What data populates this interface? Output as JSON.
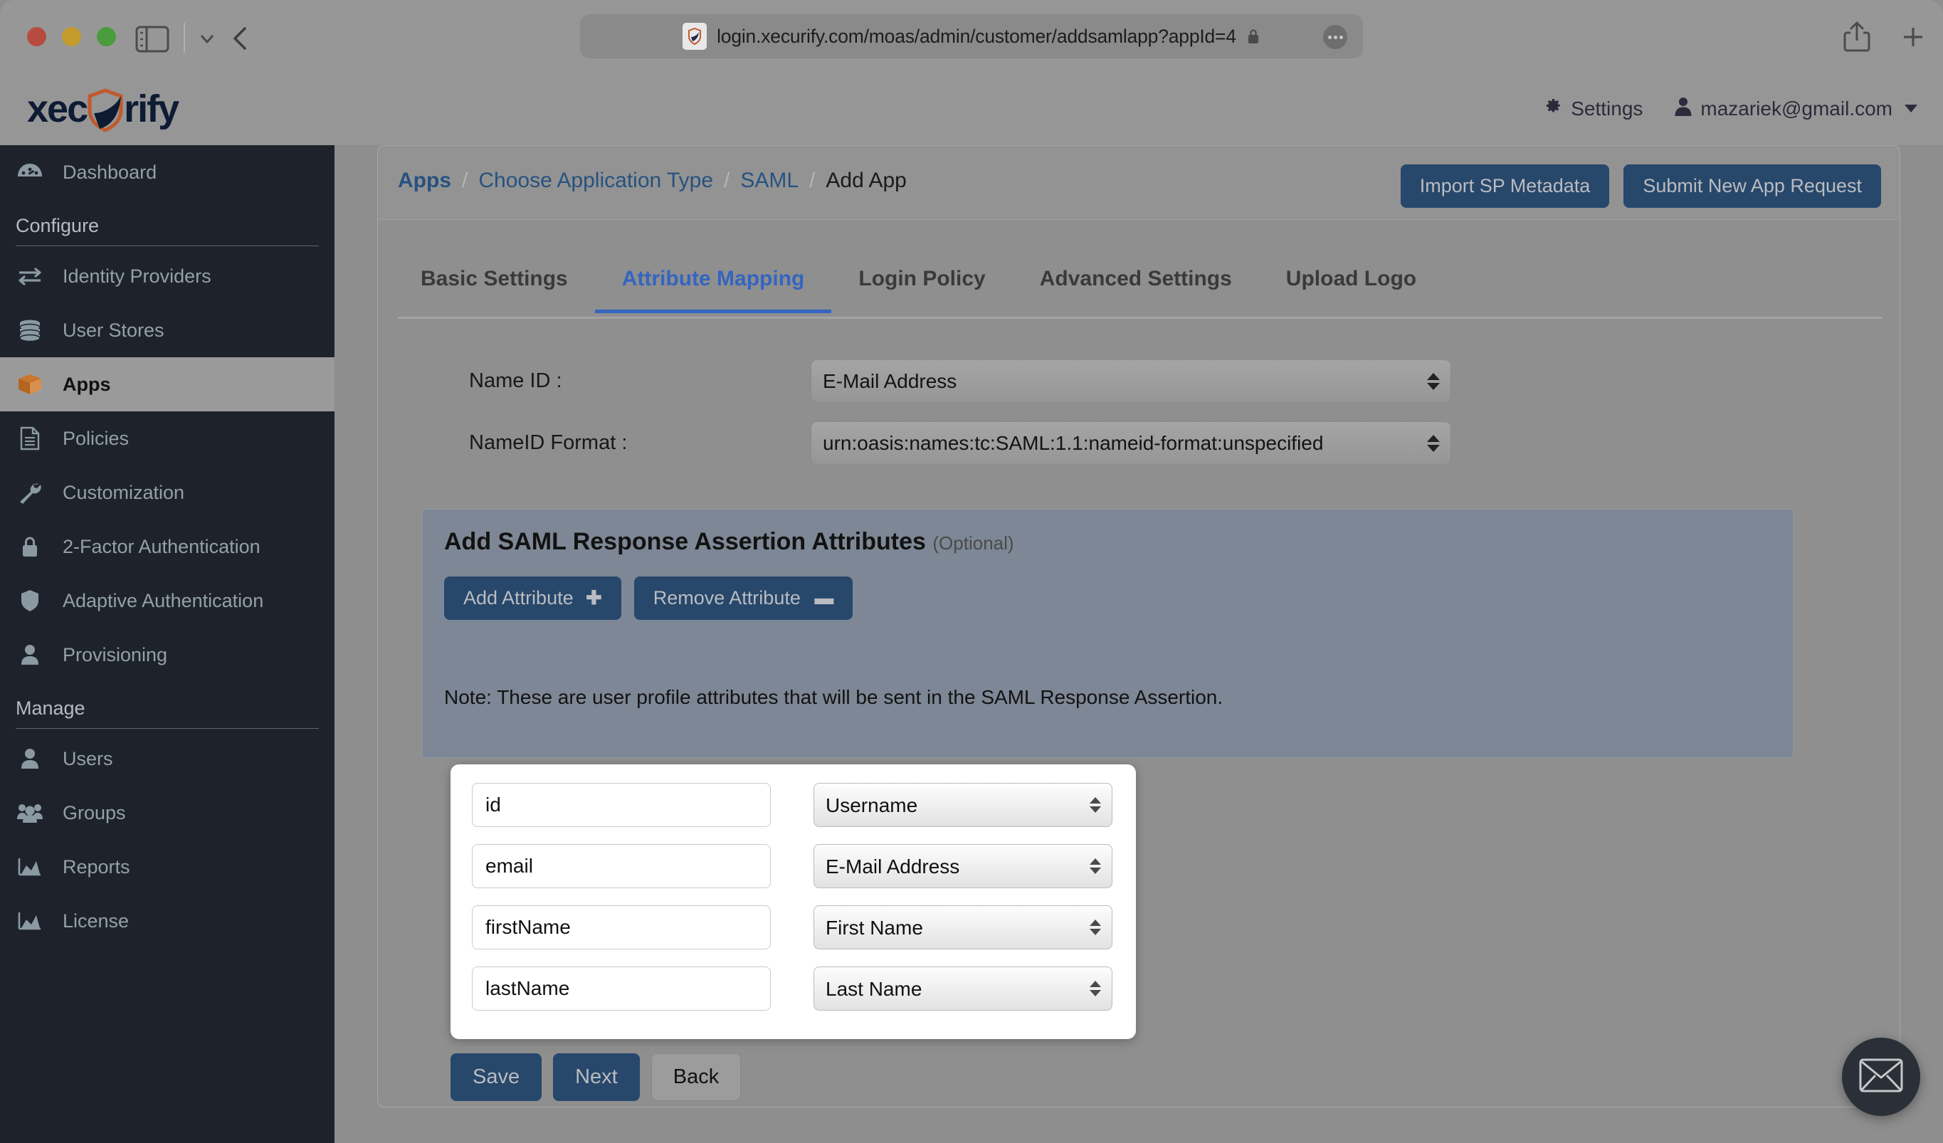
{
  "browser": {
    "url": "login.xecurify.com/moas/admin/customer/addsamlapp?appId=4",
    "icons": {
      "traffic_red": "close-window-button",
      "traffic_yellow": "minimize-window-button",
      "traffic_green": "maximize-window-button",
      "sidebar_toggle": "sidebar-toggle-icon",
      "chevron": "chevron-down-icon",
      "back": "back-arrow-icon",
      "favicon": "site-favicon-icon",
      "lock": "lock-icon",
      "more": "more-options-icon",
      "share": "share-icon",
      "newtab": "new-tab-icon"
    }
  },
  "app_header": {
    "logo_text_left": "xec",
    "logo_text_right": "rify",
    "settings_label": "Settings",
    "user_email": "mazariek@gmail.com"
  },
  "sidebar": {
    "items": [
      {
        "label": "Dashboard",
        "icon": "dashboard-icon",
        "type": "item",
        "active": false
      },
      {
        "label": "Configure",
        "type": "section"
      },
      {
        "label": "Identity Providers",
        "icon": "exchange-arrows-icon",
        "type": "item",
        "active": false
      },
      {
        "label": "User Stores",
        "icon": "database-icon",
        "type": "item",
        "active": false
      },
      {
        "label": "Apps",
        "icon": "box-icon",
        "type": "item",
        "active": true
      },
      {
        "label": "Policies",
        "icon": "document-icon",
        "type": "item",
        "active": false
      },
      {
        "label": "Customization",
        "icon": "wrench-icon",
        "type": "item",
        "active": false
      },
      {
        "label": "2-Factor Authentication",
        "icon": "lock-icon",
        "type": "item",
        "active": false
      },
      {
        "label": "Adaptive Authentication",
        "icon": "shield-icon",
        "type": "item",
        "active": false
      },
      {
        "label": "Provisioning",
        "icon": "user-icon",
        "type": "item",
        "active": false
      },
      {
        "label": "Manage",
        "type": "section"
      },
      {
        "label": "Users",
        "icon": "user-icon",
        "type": "item",
        "active": false
      },
      {
        "label": "Groups",
        "icon": "users-group-icon",
        "type": "item",
        "active": false
      },
      {
        "label": "Reports",
        "icon": "chart-icon",
        "type": "item",
        "active": false
      },
      {
        "label": "License",
        "icon": "chart-icon",
        "type": "item",
        "active": false
      }
    ]
  },
  "breadcrumb": {
    "apps": "Apps",
    "sep": "/",
    "choose_type": "Choose Application Type",
    "saml": "SAML",
    "current": "Add App"
  },
  "head_actions": {
    "import_metadata": "Import SP Metadata",
    "submit_request": "Submit New App Request"
  },
  "tabs": [
    {
      "label": "Basic Settings",
      "active": false
    },
    {
      "label": "Attribute Mapping",
      "active": true
    },
    {
      "label": "Login Policy",
      "active": false
    },
    {
      "label": "Advanced Settings",
      "active": false
    },
    {
      "label": "Upload Logo",
      "active": false
    }
  ],
  "form": {
    "name_id_label": "Name ID :",
    "name_id_value": "E-Mail Address",
    "nameid_format_label": "NameID Format :",
    "nameid_format_value": "urn:oasis:names:tc:SAML:1.1:nameid-format:unspecified"
  },
  "assertion": {
    "title": "Add SAML Response Assertion Attributes",
    "optional": "(Optional)",
    "add_attribute": "Add Attribute",
    "remove_attribute": "Remove Attribute",
    "note": "Note: These are user profile attributes that will be sent in the SAML Response Assertion."
  },
  "attribute_rows": [
    {
      "name": "id",
      "mapped": "Username"
    },
    {
      "name": "email",
      "mapped": "E-Mail Address"
    },
    {
      "name": "firstName",
      "mapped": "First Name"
    },
    {
      "name": "lastName",
      "mapped": "Last Name"
    }
  ],
  "bottom_buttons": {
    "save": "Save",
    "next": "Next",
    "back": "Back"
  },
  "fab": {
    "icon": "envelope-icon"
  },
  "colors": {
    "accent_blue": "#27476b",
    "link_blue": "#27527f",
    "tab_active": "#3465c0",
    "sidebar_bg": "#1e232b",
    "panel_bg": "#7d8795",
    "logo_shield": "#c05a2e"
  }
}
